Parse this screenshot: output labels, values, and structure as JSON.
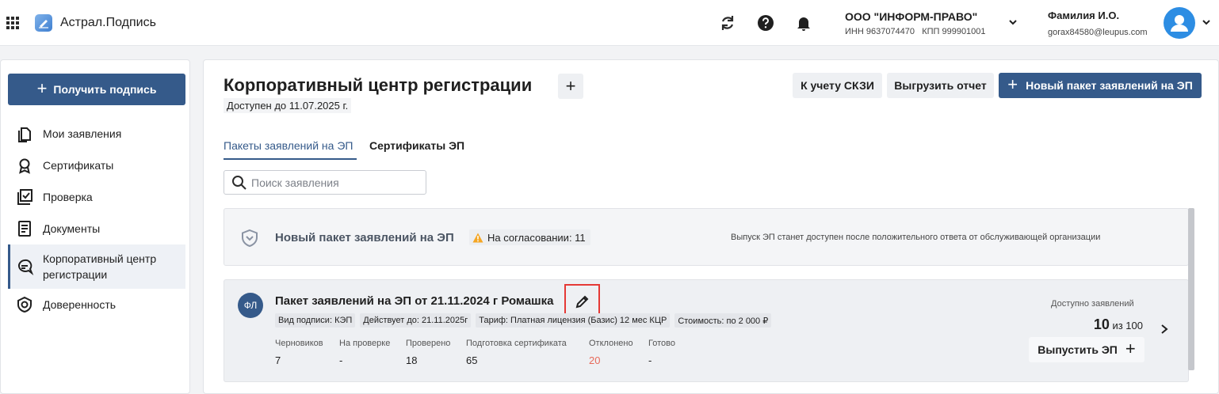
{
  "header": {
    "app_title": "Астрал.Подпись",
    "org": {
      "name": "ООО \"ИНФОРМ-ПРАВО\"",
      "inn_kpp": "ИНН 9637074470   КПП 999901001"
    },
    "user": {
      "name": "Фамилия И.О.",
      "email": "gorax84580@leupus.com"
    }
  },
  "sidebar": {
    "get_signature": "Получить подпись",
    "items": [
      {
        "label": "Мои заявления",
        "icon": "copy-document-icon"
      },
      {
        "label": "Сертификаты",
        "icon": "award-icon"
      },
      {
        "label": "Проверка",
        "icon": "checkbox-icon"
      },
      {
        "label": "Документы",
        "icon": "document-icon"
      },
      {
        "label": "Корпоративный центр регистрации",
        "icon": "chat-bubble-icon",
        "active": true
      },
      {
        "label": "Доверенность",
        "icon": "shield-check-icon"
      }
    ]
  },
  "main": {
    "title": "Корпоративный центр регистрации",
    "available_until": "Доступен до 11.07.2025 г.",
    "buttons": {
      "skzi": "К учету СКЗИ",
      "export": "Выгрузить отчет",
      "new_package": "Новый пакет заявлений на ЭП"
    },
    "tabs": [
      {
        "label": "Пакеты заявлений на ЭП",
        "active": true
      },
      {
        "label": "Сертификаты ЭП"
      }
    ],
    "search_placeholder": "Поиск заявления",
    "card1": {
      "title": "Новый пакет заявлений на ЭП",
      "badge": "На согласовании: 11",
      "note": "Выпуск ЭП станет доступен после положительного ответа от обслуживающей организации"
    },
    "card2": {
      "avatar": "ФЛ",
      "title": "Пакет заявлений на ЭП от 21.11.2024 г Ромашка",
      "tags": [
        "Вид подписи: КЭП",
        "Действует до: 21.11.2025г",
        "Тариф: Платная лицензия (Базис) 12 мес КЦР",
        "Стоимость: по 2 000 ₽"
      ],
      "stats": [
        {
          "label": "Черновиков",
          "value": "7"
        },
        {
          "label": "На проверке",
          "value": "-"
        },
        {
          "label": "Проверено",
          "value": "18"
        },
        {
          "label": "Подготовка сертификата",
          "value": "65"
        },
        {
          "label": "Отклонено",
          "value": "20"
        },
        {
          "label": "Готово",
          "value": "-"
        }
      ],
      "available_label": "Доступно заявлений",
      "available_count": "10",
      "available_total": "из 100",
      "issue_button": "Выпустить ЭП"
    }
  },
  "colors": {
    "primary": "#355a8a",
    "accent_blue": "#2d8de3",
    "rejected": "#e86a5a",
    "warning": "#f5a623",
    "highlight_border": "#e53935"
  }
}
